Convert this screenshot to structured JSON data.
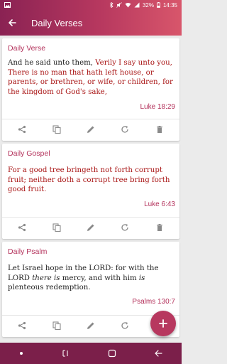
{
  "status": {
    "battery": "32%",
    "time": "14:35"
  },
  "appbar": {
    "title": "Daily Verses"
  },
  "cards": [
    {
      "title": "Daily Verse",
      "text_plain": "And he said unto them, ",
      "text_highlight": "Verily I say unto you, There is no man that hath left house, or parents, or brethren, or wife, or children, for the kingdom of God's sake,",
      "reference": "Luke 18:29"
    },
    {
      "title": "Daily Gospel",
      "text_highlight": "For a good tree bringeth not forth corrupt fruit; neither doth a corrupt tree bring forth good fruit.",
      "reference": "Luke 6:43"
    },
    {
      "title": "Daily Psalm",
      "text_1": "Let Israel hope in the LORD: for with the LORD ",
      "text_italic_1": "there is",
      "text_2": " mercy, and with him ",
      "text_italic_2": "is",
      "text_3": " plenteous redemption.",
      "reference": "Psalms 130:7"
    }
  ],
  "icons": [
    "share-icon",
    "copy-icon",
    "edit-icon",
    "refresh-icon",
    "delete-icon"
  ],
  "colors": {
    "accent": "#b3305a",
    "highlight": "#a91515",
    "nav": "#7b1f4a"
  }
}
